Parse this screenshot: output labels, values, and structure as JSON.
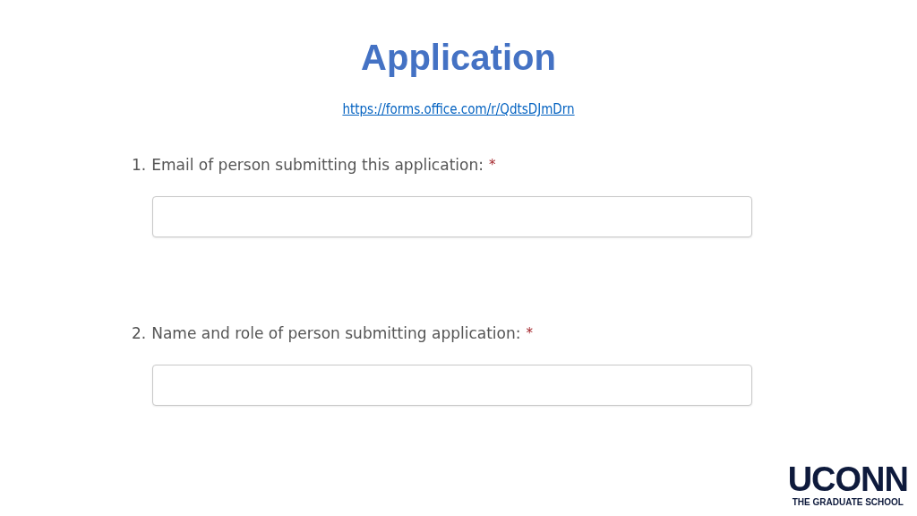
{
  "title": "Application",
  "link": "https://forms.office.com/r/QdtsDJmDrn",
  "questions": [
    {
      "number": "1.",
      "text": "Email of person submitting this application:",
      "required_mark": "*"
    },
    {
      "number": "2.",
      "text": "Name and role of person submitting application:",
      "required_mark": "*"
    }
  ],
  "logo": {
    "wordmark": "UCONN",
    "subtitle": "THE GRADUATE SCHOOL"
  }
}
